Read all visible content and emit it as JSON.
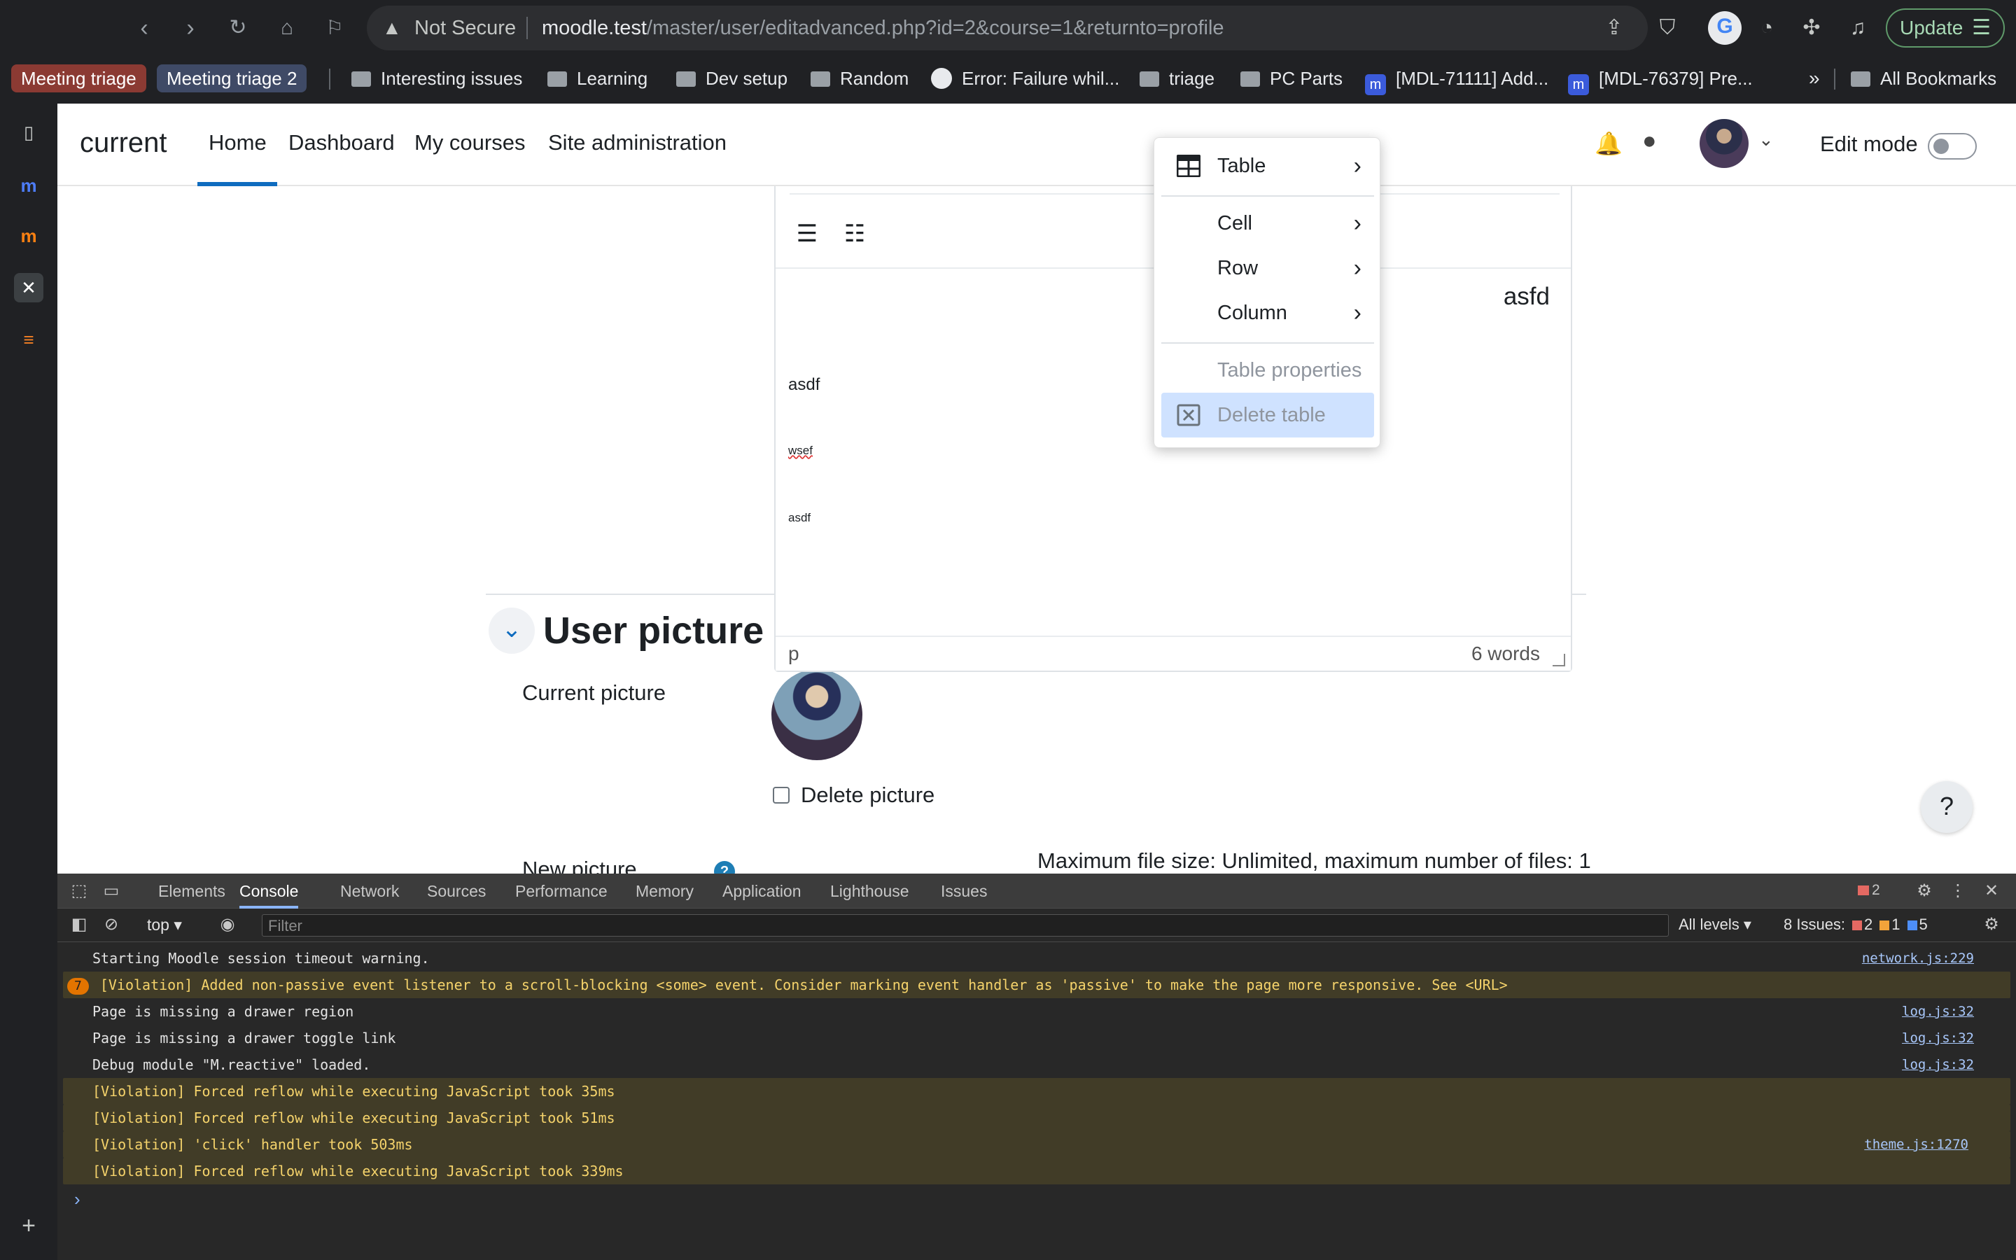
{
  "browser": {
    "url_warning": "Not Secure",
    "url_host": "moodle.test",
    "url_path": "/master/user/editadvanced.php?id=2&course=1&returnto=profile",
    "update_label": "Update"
  },
  "bookmarks": {
    "tags": [
      {
        "label": "Meeting triage",
        "color": "#8b3a33"
      },
      {
        "label": "Meeting triage 2",
        "color": "#3f4a66"
      }
    ],
    "items": [
      "Interesting issues",
      "Learning",
      "Dev setup",
      "Random",
      "Error: Failure whil...",
      "triage",
      "PC Parts",
      "[MDL-71111] Add...",
      "[MDL-76379] Pre..."
    ],
    "more": "»",
    "all_bookmarks": "All Bookmarks"
  },
  "moodle_nav": {
    "brand": "current",
    "links": [
      "Home",
      "Dashboard",
      "My courses",
      "Site administration"
    ],
    "edit_mode_label": "Edit mode"
  },
  "editor": {
    "content_lines": [
      "asfd",
      "asdf",
      "wsef",
      "asdf"
    ],
    "status_path": "p",
    "word_count": "6 words"
  },
  "context_menu": {
    "items": [
      {
        "label": "Table",
        "submenu": true
      },
      {
        "label": "Cell",
        "submenu": true
      },
      {
        "label": "Row",
        "submenu": true
      },
      {
        "label": "Column",
        "submenu": true
      },
      {
        "label": "Table properties",
        "disabled": true
      },
      {
        "label": "Delete table",
        "disabled": true,
        "highlighted": true
      }
    ]
  },
  "user_picture": {
    "section_title": "User picture",
    "current_picture_label": "Current picture",
    "delete_picture_label": "Delete picture",
    "new_picture_label": "New picture",
    "max_file_text": "Maximum file size: Unlimited, maximum number of files: 1",
    "help_label": "?"
  },
  "devtools": {
    "tabs": [
      "Elements",
      "Console",
      "Network",
      "Sources",
      "Performance",
      "Memory",
      "Application",
      "Lighthouse",
      "Issues"
    ],
    "active_tab": "Console",
    "error_badge": "2",
    "context": "top",
    "filter_placeholder": "Filter",
    "levels": "All levels",
    "issues_label": "8 Issues:",
    "issues_errors": "2",
    "issues_warnings": "1",
    "issues_info": "5",
    "log": [
      {
        "text": "Starting Moodle session timeout warning.",
        "source": "network.js:229",
        "level": "info"
      },
      {
        "text": "[Violation] Added non-passive event listener to a scroll-blocking <some> event. Consider marking event handler as 'passive' to make the page more responsive. See <URL>",
        "source": "",
        "level": "warn",
        "count": "7"
      },
      {
        "text": "Page is missing a drawer region",
        "source": "log.js:32",
        "level": "info"
      },
      {
        "text": "Page is missing a drawer toggle link",
        "source": "log.js:32",
        "level": "info"
      },
      {
        "text": "Debug module \"M.reactive\" loaded.",
        "source": "log.js:32",
        "level": "info"
      },
      {
        "text": "[Violation] Forced reflow while executing JavaScript took 35ms",
        "source": "",
        "level": "warn"
      },
      {
        "text": "[Violation] Forced reflow while executing JavaScript took 51ms",
        "source": "",
        "level": "warn"
      },
      {
        "text": "[Violation] 'click' handler took 503ms",
        "source": "theme.js:1270",
        "level": "warn"
      },
      {
        "text": "[Violation] Forced reflow while executing JavaScript took 339ms",
        "source": "",
        "level": "warn"
      }
    ],
    "prompt": "›"
  }
}
